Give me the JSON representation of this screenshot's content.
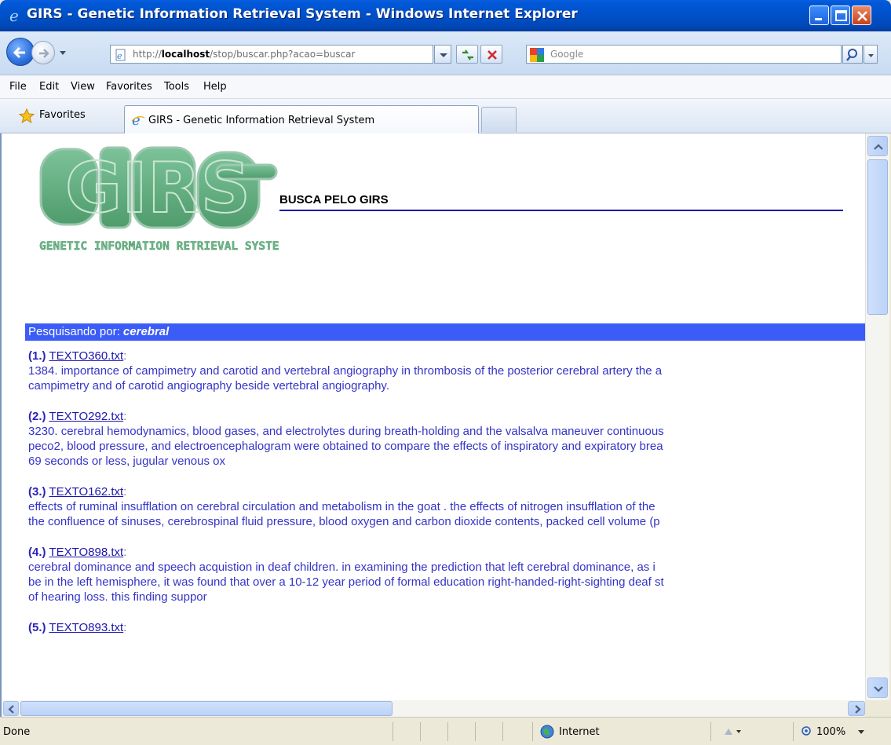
{
  "window": {
    "title": "GIRS - Genetic Information Retrieval System - Windows Internet Explorer"
  },
  "address_bar": {
    "url_prefix": "http://",
    "url_host": "localhost",
    "url_path": "/stop/buscar.php?acao=buscar",
    "search_placeholder": "Google"
  },
  "menu": [
    "File",
    "Edit",
    "View",
    "Favorites",
    "Tools",
    "Help"
  ],
  "favorites_label": "Favorites",
  "tab": {
    "label": "GIRS - Genetic Information Retrieval System"
  },
  "page": {
    "logo_text": "GIRS",
    "logo_subtext": "GENETIC INFORMATION RETRIEVAL SYSTEM",
    "heading": "BUSCA PELO GIRS",
    "search_prefix": "Pesquisando por: ",
    "search_term": "cerebral",
    "results": [
      {
        "num": "(1.)",
        "file": "TEXTO360.txt",
        "lines": [
          "1384. importance of campimetry and carotid and vertebral angiography in thrombosis of the posterior cerebral artery the a",
          "campimetry and of carotid angiography beside vertebral angiography."
        ]
      },
      {
        "num": "(2.)",
        "file": "TEXTO292.txt",
        "lines": [
          "3230. cerebral hemodynamics, blood gases, and electrolytes during breath-holding and the valsalva maneuver continuous",
          "peco2, blood pressure, and electroencephalogram were obtained to compare the effects of inspiratory and expiratory brea",
          "69 seconds or less, jugular venous ox"
        ]
      },
      {
        "num": "(3.)",
        "file": "TEXTO162.txt",
        "lines": [
          "effects of ruminal insufflation on cerebral circulation and metabolism in the goat . the effects of nitrogen insufflation of the",
          "the confluence of sinuses, cerebrospinal fluid pressure, blood oxygen and carbon dioxide contents, packed cell volume (p"
        ]
      },
      {
        "num": "(4.)",
        "file": "TEXTO898.txt",
        "lines": [
          "cerebral dominance and speech acquistion in deaf children. in examining the prediction that left cerebral dominance, as i",
          "be in the left hemisphere, it was found that over a 10-12 year period of formal education right-handed-right-sighting deaf st",
          "of hearing loss. this finding suppor"
        ]
      },
      {
        "num": "(5.)",
        "file": "TEXTO893.txt",
        "lines": []
      }
    ]
  },
  "status": {
    "text": "Done",
    "zone": "Internet",
    "zoom": "100%"
  },
  "colors": {
    "banner": "#3b5cf6",
    "result_text": "#3434c8",
    "logo_green": "#5aa878"
  }
}
